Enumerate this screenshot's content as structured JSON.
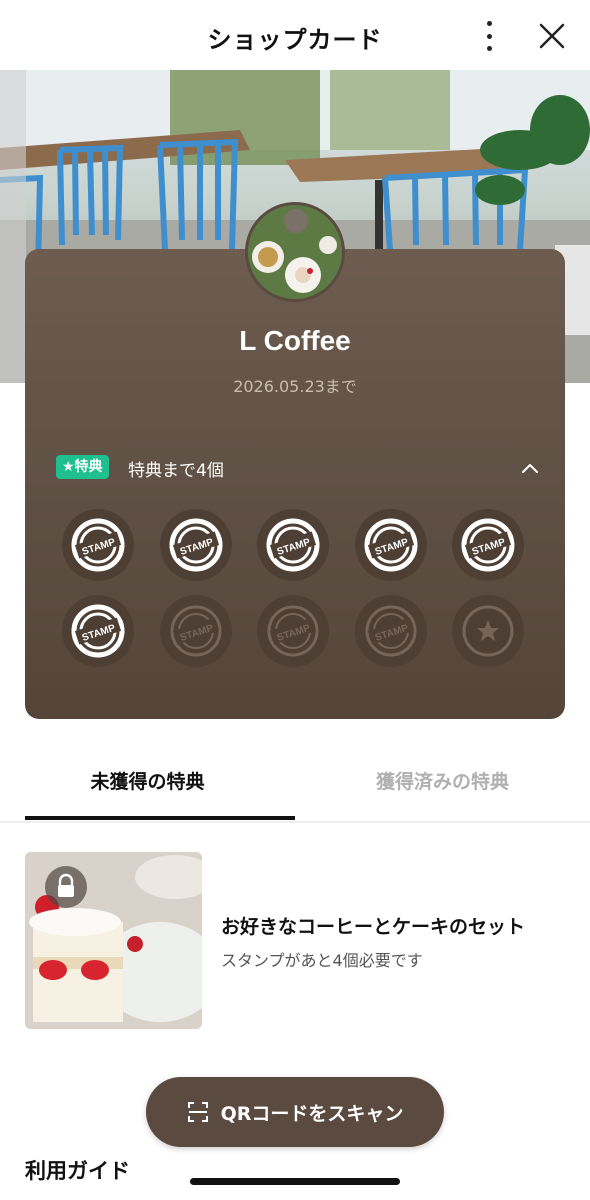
{
  "header": {
    "title": "ショップカード",
    "more_icon": "more-vertical-icon",
    "close_icon": "close-icon"
  },
  "card": {
    "shop_name": "L Coffee",
    "expiry": "2026.05.23まで",
    "reward_badge": "★特典",
    "reward_status": "特典まで4個",
    "stamp_label": "STAMP",
    "stamps_total": 10,
    "stamps_collected": 6,
    "final_stamp_icon": "star-icon",
    "colors": {
      "card": "#5e4f44",
      "badge": "#1fbf8f"
    }
  },
  "tabs": [
    {
      "label": "未獲得の特典",
      "active": true
    },
    {
      "label": "獲得済みの特典",
      "active": false
    }
  ],
  "reward": {
    "title": "お好きなコーヒーとケーキのセット",
    "subtitle": "スタンプがあと4個必要です",
    "lock_icon": "lock-icon"
  },
  "qr_button": {
    "label": "QRコードをスキャン",
    "icon": "scan-icon"
  },
  "guide": {
    "title": "利用ガイド"
  }
}
